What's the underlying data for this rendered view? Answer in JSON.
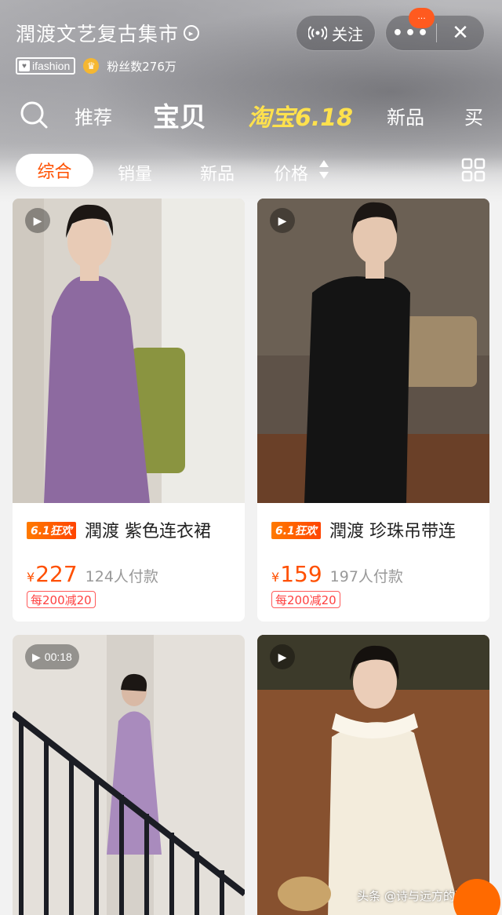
{
  "shop": {
    "name": "潤渡文艺复古集市",
    "badge": "ifashion",
    "fans": "粉丝数276万",
    "follow_label": "关注",
    "more_label": "•••",
    "close_label": "✕",
    "message_dot": "···"
  },
  "main_tabs": [
    {
      "label": "推荐"
    },
    {
      "label": "宝贝",
      "active": true
    },
    {
      "label": "淘宝6.18",
      "promo": true
    },
    {
      "label": "新品"
    },
    {
      "label": "买"
    }
  ],
  "sort_tabs": [
    {
      "label": "综合",
      "active": true
    },
    {
      "label": "销量"
    },
    {
      "label": "新品"
    },
    {
      "label": "价格"
    }
  ],
  "products": [
    {
      "promo_tag": "6.1狂欢",
      "title": "潤渡 紫色连衣裙",
      "currency": "¥",
      "price": "227",
      "sold": "124人付款",
      "coupon": "每200减20",
      "media": "play-icon"
    },
    {
      "promo_tag": "6.1狂欢",
      "title": "潤渡 珍珠吊带连",
      "currency": "¥",
      "price": "159",
      "sold": "197人付款",
      "coupon": "每200减20",
      "media": "play-icon"
    },
    {
      "media": "play-icon",
      "video_duration": "00:18"
    },
    {
      "media": "play-icon"
    }
  ],
  "watermark": "头条 @诗与远方的骗子",
  "colors": {
    "accent": "#ff5000",
    "promo_yellow": "#ffe14d",
    "coupon_red": "#ff4040"
  }
}
